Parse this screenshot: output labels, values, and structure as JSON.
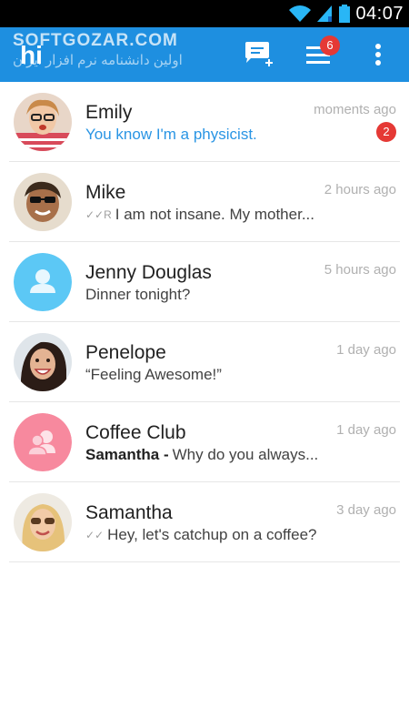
{
  "status_bar": {
    "time": "04:07"
  },
  "app_bar": {
    "logo_text": "hi",
    "watermark_title": "SOFTGOZAR.COM",
    "watermark_subtitle": "اولین دانشنامه نرم افزار ایران",
    "menu_badge": "6",
    "accent_color": "#1e8fe0",
    "badge_color": "#e53935",
    "icons": [
      "new-message-icon",
      "menu-icon",
      "more-options-icon"
    ]
  },
  "chats": [
    {
      "name": "Emily",
      "time": "moments ago",
      "message": "You know I'm a physicist.",
      "unread_count": "2",
      "avatar": "photo"
    },
    {
      "name": "Mike",
      "time": "2 hours ago",
      "message": "I am not insane. My mother...",
      "receipt": "✓✓R",
      "avatar": "photo"
    },
    {
      "name": "Jenny Douglas",
      "time": "5 hours ago",
      "message": "Dinner tonight?",
      "avatar": "default-person-icon",
      "avatar_color": "#5cc8f5"
    },
    {
      "name": "Penelope",
      "time": "1 day ago",
      "message": "“Feeling Awesome!”",
      "avatar": "photo"
    },
    {
      "name": "Coffee Club",
      "time": "1 day ago",
      "sender": "Samantha -",
      "message": "Why do you always...",
      "avatar": "group-icon",
      "avatar_color": "#f7899e"
    },
    {
      "name": "Samantha",
      "time": "3 day ago",
      "message": "Hey, let's catchup on a coffee?",
      "receipt": "✓✓",
      "avatar": "photo"
    }
  ]
}
